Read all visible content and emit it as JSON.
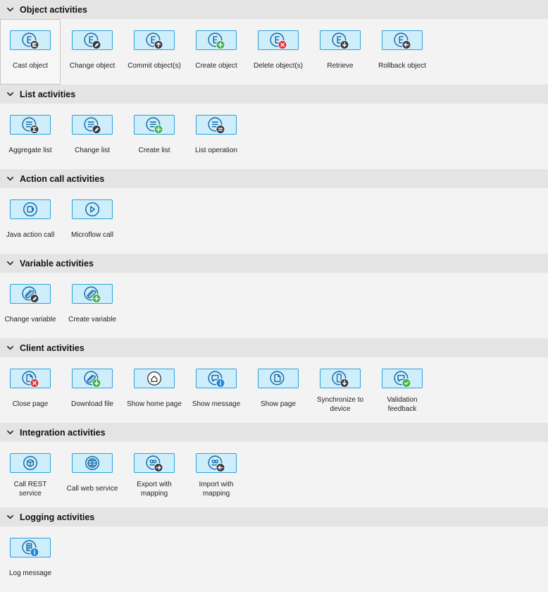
{
  "colors": {
    "tile_fill": "#cfeefc",
    "tile_border": "#2da1d8",
    "icon_stroke": "#1f6fa8",
    "badge_dark": "#3a3d45",
    "badge_green": "#3cb44b",
    "badge_red": "#e0333b",
    "badge_blue": "#1e88d6"
  },
  "sections": [
    {
      "title": "Object activities",
      "items": [
        {
          "label": "Cast object",
          "icon": "entity-cast-icon",
          "base": "E",
          "badge": "cast",
          "badgeColor": "#3a3d45",
          "selected": true
        },
        {
          "label": "Change object",
          "icon": "entity-change-icon",
          "base": "E",
          "badge": "pencil",
          "badgeColor": "#3a3d45"
        },
        {
          "label": "Commit object(s)",
          "icon": "entity-commit-icon",
          "base": "E",
          "badge": "up",
          "badgeColor": "#3a3d45"
        },
        {
          "label": "Create object",
          "icon": "entity-create-icon",
          "base": "E",
          "badge": "plus",
          "badgeColor": "#3cb44b"
        },
        {
          "label": "Delete object(s)",
          "icon": "entity-delete-icon",
          "base": "E",
          "badge": "x",
          "badgeColor": "#e0333b"
        },
        {
          "label": "Retrieve",
          "icon": "entity-retrieve-icon",
          "base": "E",
          "badge": "down",
          "badgeColor": "#3a3d45"
        },
        {
          "label": "Rollback object",
          "icon": "entity-rollback-icon",
          "base": "E",
          "badge": "left",
          "badgeColor": "#3a3d45"
        }
      ]
    },
    {
      "title": "List activities",
      "items": [
        {
          "label": "Aggregate list",
          "icon": "list-aggregate-icon",
          "base": "list",
          "badge": "sigma",
          "badgeColor": "#3a3d45"
        },
        {
          "label": "Change list",
          "icon": "list-change-icon",
          "base": "list",
          "badge": "pencil",
          "badgeColor": "#3a3d45"
        },
        {
          "label": "Create list",
          "icon": "list-create-icon",
          "base": "list",
          "badge": "plus",
          "badgeColor": "#3cb44b"
        },
        {
          "label": "List operation",
          "icon": "list-operation-icon",
          "base": "list",
          "badge": "equals",
          "badgeColor": "#3a3d45"
        }
      ]
    },
    {
      "title": "Action call activities",
      "items": [
        {
          "label": "Java action call",
          "icon": "java-action-icon",
          "base": "java",
          "badge": "",
          "badgeColor": ""
        },
        {
          "label": "Microflow call",
          "icon": "microflow-call-icon",
          "base": "play",
          "badge": "",
          "badgeColor": ""
        }
      ]
    },
    {
      "title": "Variable activities",
      "items": [
        {
          "label": "Change variable",
          "icon": "variable-change-icon",
          "base": "var",
          "badge": "pencil",
          "badgeColor": "#3a3d45"
        },
        {
          "label": "Create variable",
          "icon": "variable-create-icon",
          "base": "var",
          "badge": "plus",
          "badgeColor": "#3cb44b"
        }
      ]
    },
    {
      "title": "Client activities",
      "items": [
        {
          "label": "Close page",
          "icon": "close-page-icon",
          "base": "page",
          "badge": "x",
          "badgeColor": "#e0333b"
        },
        {
          "label": "Download file",
          "icon": "download-file-icon",
          "base": "clip",
          "badge": "down",
          "badgeColor": "#3cb44b"
        },
        {
          "label": "Show home page",
          "icon": "home-page-icon",
          "base": "home",
          "badge": "",
          "badgeColor": ""
        },
        {
          "label": "Show message",
          "icon": "show-message-icon",
          "base": "chat",
          "badge": "info",
          "badgeColor": "#1e88d6"
        },
        {
          "label": "Show page",
          "icon": "show-page-icon",
          "base": "page",
          "badge": "",
          "badgeColor": ""
        },
        {
          "label": "Synchronize to device",
          "icon": "sync-device-icon",
          "base": "device",
          "badge": "down",
          "badgeColor": "#3a3d45"
        },
        {
          "label": "Validation feedback",
          "icon": "validation-feedback-icon",
          "base": "chat",
          "badge": "check",
          "badgeColor": "#3cb44b"
        }
      ]
    },
    {
      "title": "Integration activities",
      "items": [
        {
          "label": "Call REST service",
          "icon": "rest-service-icon",
          "base": "cube",
          "badge": "",
          "badgeColor": ""
        },
        {
          "label": "Call web service",
          "icon": "web-service-icon",
          "base": "globe",
          "badge": "",
          "badgeColor": ""
        },
        {
          "label": "Export with mapping",
          "icon": "export-mapping-icon",
          "base": "mapping",
          "badge": "right",
          "badgeColor": "#3a3d45"
        },
        {
          "label": "Import with mapping",
          "icon": "import-mapping-icon",
          "base": "mapping",
          "badge": "left",
          "badgeColor": "#3a3d45"
        }
      ]
    },
    {
      "title": "Logging activities",
      "items": [
        {
          "label": "Log message",
          "icon": "log-message-icon",
          "base": "doc",
          "badge": "info",
          "badgeColor": "#1e88d6"
        }
      ]
    }
  ]
}
